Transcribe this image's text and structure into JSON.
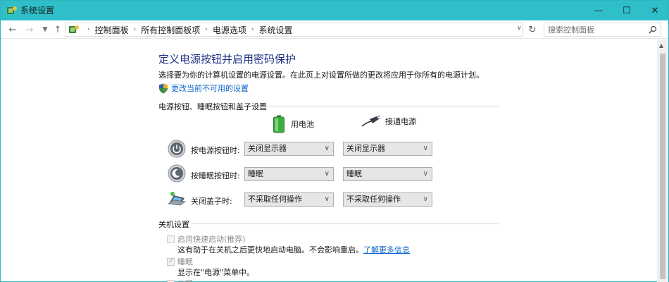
{
  "window": {
    "title": "系统设置",
    "controls": {
      "minimize": "—",
      "maximize": "☐",
      "close": "✕"
    }
  },
  "nav": {
    "breadcrumbs": [
      "控制面板",
      "所有控制面板项",
      "电源选项",
      "系统设置"
    ],
    "search_placeholder": "搜索控制面板"
  },
  "main": {
    "heading": "定义电源按钮并启用密码保护",
    "description": "选择要为你的计算机设置的电源设置。在此页上对设置所做的更改将应用于你所有的电源计划。",
    "change_link": "更改当前不可用的设置",
    "power_section": {
      "title": "电源按钮、睡眠按钮和盖子设置",
      "columns": {
        "battery": "用电池",
        "plugged": "接通电源"
      },
      "rows": [
        {
          "label": "按电源按钮时:",
          "battery": "关闭显示器",
          "plugged": "关闭显示器",
          "icon": "power-icon"
        },
        {
          "label": "按睡眠按钮时:",
          "battery": "睡眠",
          "plugged": "睡眠",
          "icon": "sleep-icon"
        },
        {
          "label": "关闭盖子时:",
          "battery": "不采取任何操作",
          "plugged": "不采取任何操作",
          "icon": "laptop-lid-icon"
        }
      ]
    },
    "shutdown_section": {
      "title": "关机设置",
      "options": [
        {
          "label": "启用快速启动(推荐)",
          "checked": false,
          "desc": "这有助于在关机之后更快地启动电脑。不会影响重启。",
          "link": "了解更多信息"
        },
        {
          "label": "睡眠",
          "checked": true,
          "desc": "显示在\"电源\"菜单中。"
        },
        {
          "label": "休眠",
          "checked": false
        }
      ]
    }
  },
  "colors": {
    "titlebar": "#2fbfc9",
    "heading": "#1e3287",
    "link": "#0a64c8"
  }
}
